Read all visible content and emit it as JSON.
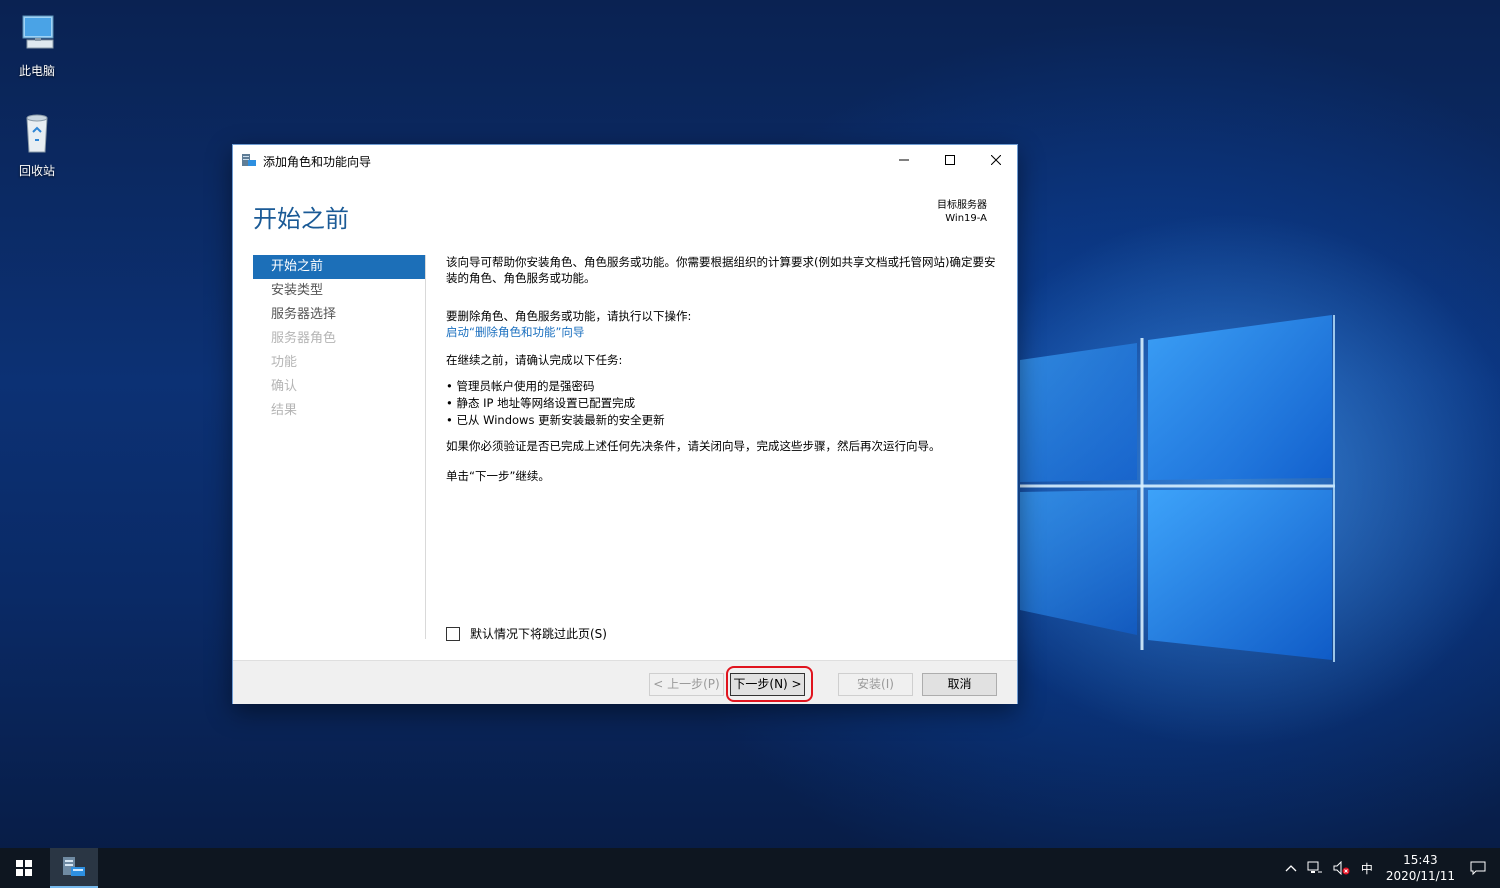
{
  "desktop": {
    "icons": [
      {
        "label": "此电脑",
        "icon": "computer-icon"
      },
      {
        "label": "回收站",
        "icon": "recycle-bin-icon"
      }
    ]
  },
  "wizard": {
    "title": "添加角色和功能向导",
    "page_heading": "开始之前",
    "target_server_label": "目标服务器",
    "target_server_name": "Win19-A",
    "nav": [
      {
        "label": "开始之前",
        "state": "active"
      },
      {
        "label": "安装类型",
        "state": "enabled"
      },
      {
        "label": "服务器选择",
        "state": "enabled"
      },
      {
        "label": "服务器角色",
        "state": "disabled"
      },
      {
        "label": "功能",
        "state": "disabled"
      },
      {
        "label": "确认",
        "state": "disabled"
      },
      {
        "label": "结果",
        "state": "disabled"
      }
    ],
    "content": {
      "intro": "该向导可帮助你安装角色、角色服务或功能。你需要根据组织的计算要求(例如共享文档或托管网站)确定要安装的角色、角色服务或功能。",
      "remove_intro": "要删除角色、角色服务或功能，请执行以下操作:",
      "remove_link": "启动“删除角色和功能”向导",
      "confirm_intro": "在继续之前，请确认完成以下任务:",
      "tasks": [
        "管理员帐户使用的是强密码",
        "静态 IP 地址等网络设置已配置完成",
        "已从 Windows 更新安装最新的安全更新"
      ],
      "verify_note": "如果你必须验证是否已完成上述任何先决条件，请关闭向导，完成这些步骤，然后再次运行向导。",
      "continue_note": "单击“下一步”继续。"
    },
    "skip_checkbox_label": "默认情况下将跳过此页(S)",
    "buttons": {
      "prev": "< 上一步(P)",
      "next": "下一步(N) >",
      "install": "安装(I)",
      "cancel": "取消"
    }
  },
  "taskbar": {
    "ime": "中",
    "time": "15:43",
    "date": "2020/11/11"
  },
  "colors": {
    "accent": "#1c6fb8",
    "heading": "#1a5a96",
    "link": "#1a6fbf",
    "highlight": "#e0141e"
  }
}
